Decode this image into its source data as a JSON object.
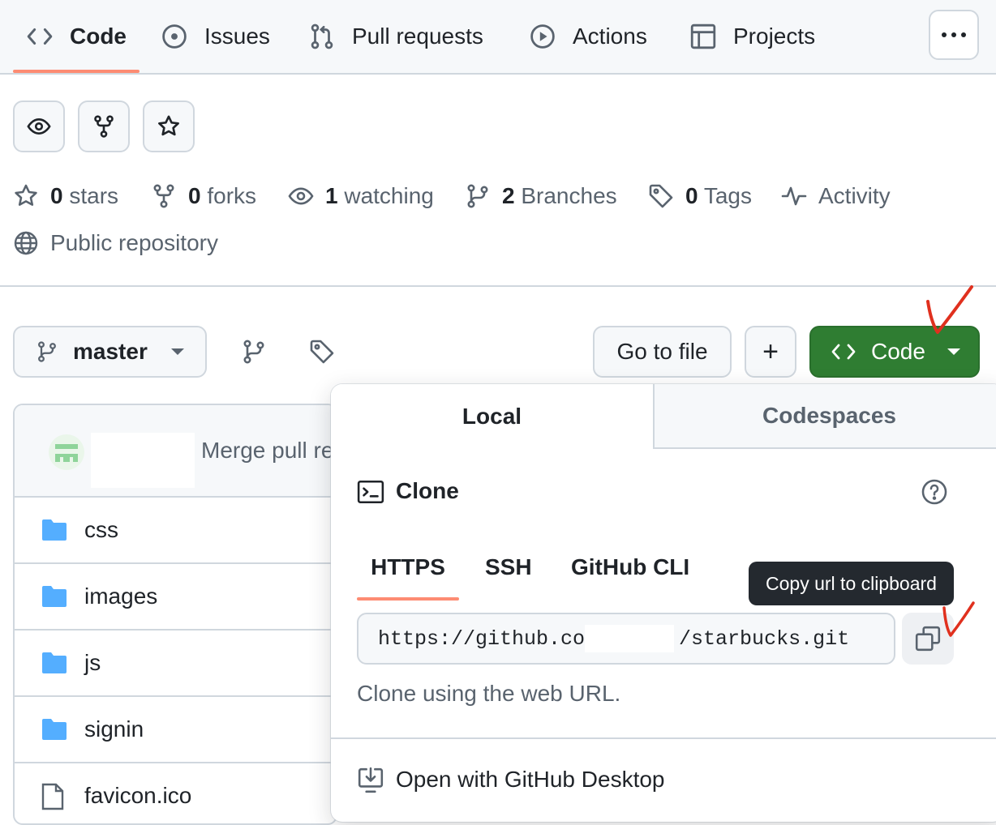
{
  "nav": {
    "tabs": [
      {
        "label": "Code",
        "icon": "code-icon",
        "active": true
      },
      {
        "label": "Issues",
        "icon": "issue-opened-icon"
      },
      {
        "label": "Pull requests",
        "icon": "git-pull-request-icon"
      },
      {
        "label": "Actions",
        "icon": "play-icon"
      },
      {
        "label": "Projects",
        "icon": "table-icon"
      }
    ],
    "more_icon": "kebab-horizontal-icon"
  },
  "repo_actions": {
    "watch_icon": "eye-icon",
    "fork_icon": "repo-forked-icon",
    "star_icon": "star-icon"
  },
  "stats": {
    "stars": {
      "count": "0",
      "label": "stars"
    },
    "forks": {
      "count": "0",
      "label": "forks"
    },
    "watching": {
      "count": "1",
      "label": "watching"
    },
    "branches": {
      "count": "2",
      "label": "Branches"
    },
    "tags": {
      "count": "0",
      "label": "Tags"
    },
    "activity": {
      "label": "Activity"
    },
    "visibility": {
      "label": "Public repository"
    }
  },
  "toolbar": {
    "branch": "master",
    "go_to_file": "Go to file",
    "add": "+",
    "code_button": "Code"
  },
  "commit": {
    "message": "Merge pull re"
  },
  "files": [
    {
      "name": "css",
      "type": "folder"
    },
    {
      "name": "images",
      "type": "folder"
    },
    {
      "name": "js",
      "type": "folder"
    },
    {
      "name": "signin",
      "type": "folder"
    },
    {
      "name": "favicon.ico",
      "type": "file"
    }
  ],
  "dropdown": {
    "tabs": [
      "Local",
      "Codespaces"
    ],
    "active_tab": "Local",
    "clone_title": "Clone",
    "protocols": [
      "HTTPS",
      "SSH",
      "GitHub CLI"
    ],
    "active_protocol": "HTTPS",
    "url_start": "https://github.co",
    "url_end": "/starbucks.git",
    "tooltip": "Copy url to clipboard",
    "help_text": "Clone using the web URL.",
    "open_desktop": "Open with GitHub Desktop"
  },
  "colors": {
    "accent_underline": "#fd8c73",
    "code_button_bg": "#2f7d32",
    "folder": "#54aeff",
    "annotation": "#e0301e"
  }
}
